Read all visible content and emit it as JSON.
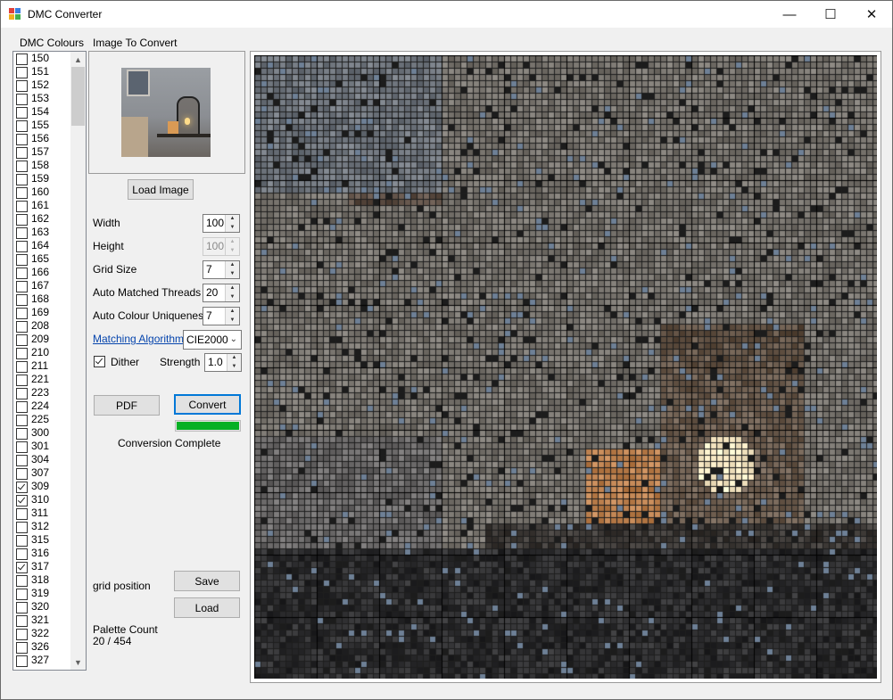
{
  "window": {
    "title": "DMC Converter",
    "minimize_glyph": "—",
    "maximize_glyph": "☐",
    "close_glyph": "✕"
  },
  "colours": {
    "header": "DMC Colours",
    "items": [
      {
        "label": "150",
        "checked": false
      },
      {
        "label": "151",
        "checked": false
      },
      {
        "label": "152",
        "checked": false
      },
      {
        "label": "153",
        "checked": false
      },
      {
        "label": "154",
        "checked": false
      },
      {
        "label": "155",
        "checked": false
      },
      {
        "label": "156",
        "checked": false
      },
      {
        "label": "157",
        "checked": false
      },
      {
        "label": "158",
        "checked": false
      },
      {
        "label": "159",
        "checked": false
      },
      {
        "label": "160",
        "checked": false
      },
      {
        "label": "161",
        "checked": false
      },
      {
        "label": "162",
        "checked": false
      },
      {
        "label": "163",
        "checked": false
      },
      {
        "label": "164",
        "checked": false
      },
      {
        "label": "165",
        "checked": false
      },
      {
        "label": "166",
        "checked": false
      },
      {
        "label": "167",
        "checked": false
      },
      {
        "label": "168",
        "checked": false
      },
      {
        "label": "169",
        "checked": false
      },
      {
        "label": "208",
        "checked": false
      },
      {
        "label": "209",
        "checked": false
      },
      {
        "label": "210",
        "checked": false
      },
      {
        "label": "211",
        "checked": false
      },
      {
        "label": "221",
        "checked": false
      },
      {
        "label": "223",
        "checked": false
      },
      {
        "label": "224",
        "checked": false
      },
      {
        "label": "225",
        "checked": false
      },
      {
        "label": "300",
        "checked": false
      },
      {
        "label": "301",
        "checked": false
      },
      {
        "label": "304",
        "checked": false
      },
      {
        "label": "307",
        "checked": false
      },
      {
        "label": "309",
        "checked": true
      },
      {
        "label": "310",
        "checked": true
      },
      {
        "label": "311",
        "checked": false
      },
      {
        "label": "312",
        "checked": false
      },
      {
        "label": "315",
        "checked": false
      },
      {
        "label": "316",
        "checked": false
      },
      {
        "label": "317",
        "checked": true
      },
      {
        "label": "318",
        "checked": false
      },
      {
        "label": "319",
        "checked": false
      },
      {
        "label": "320",
        "checked": false
      },
      {
        "label": "321",
        "checked": false
      },
      {
        "label": "322",
        "checked": false
      },
      {
        "label": "326",
        "checked": false
      },
      {
        "label": "327",
        "checked": false
      }
    ]
  },
  "image_section": {
    "label": "Image To Convert",
    "load_button": "Load Image"
  },
  "settings": {
    "width_label": "Width",
    "width_value": "100",
    "height_label": "Height",
    "height_value": "100",
    "grid_label": "Grid Size",
    "grid_value": "7",
    "threads_label": "Auto Matched Threads",
    "threads_value": "20",
    "uniqueness_label": "Auto Colour Uniqueness",
    "uniqueness_value": "7",
    "algorithm_label": "Matching Algorithm",
    "algorithm_value": "CIE2000",
    "dither_label": "Dither",
    "dither_checked": true,
    "strength_label": "Strength",
    "strength_value": "1.0"
  },
  "actions": {
    "pdf_button": "PDF",
    "convert_button": "Convert",
    "progress": 1.0,
    "status": "Conversion Complete",
    "grid_position_label": "grid position",
    "save_button": "Save",
    "load_button": "Load",
    "palette_label": "Palette Count",
    "palette_value": "20 / 454"
  },
  "colors": {
    "accent": "#0078d7",
    "progress_fill": "#06b025",
    "link": "#0645ad"
  }
}
